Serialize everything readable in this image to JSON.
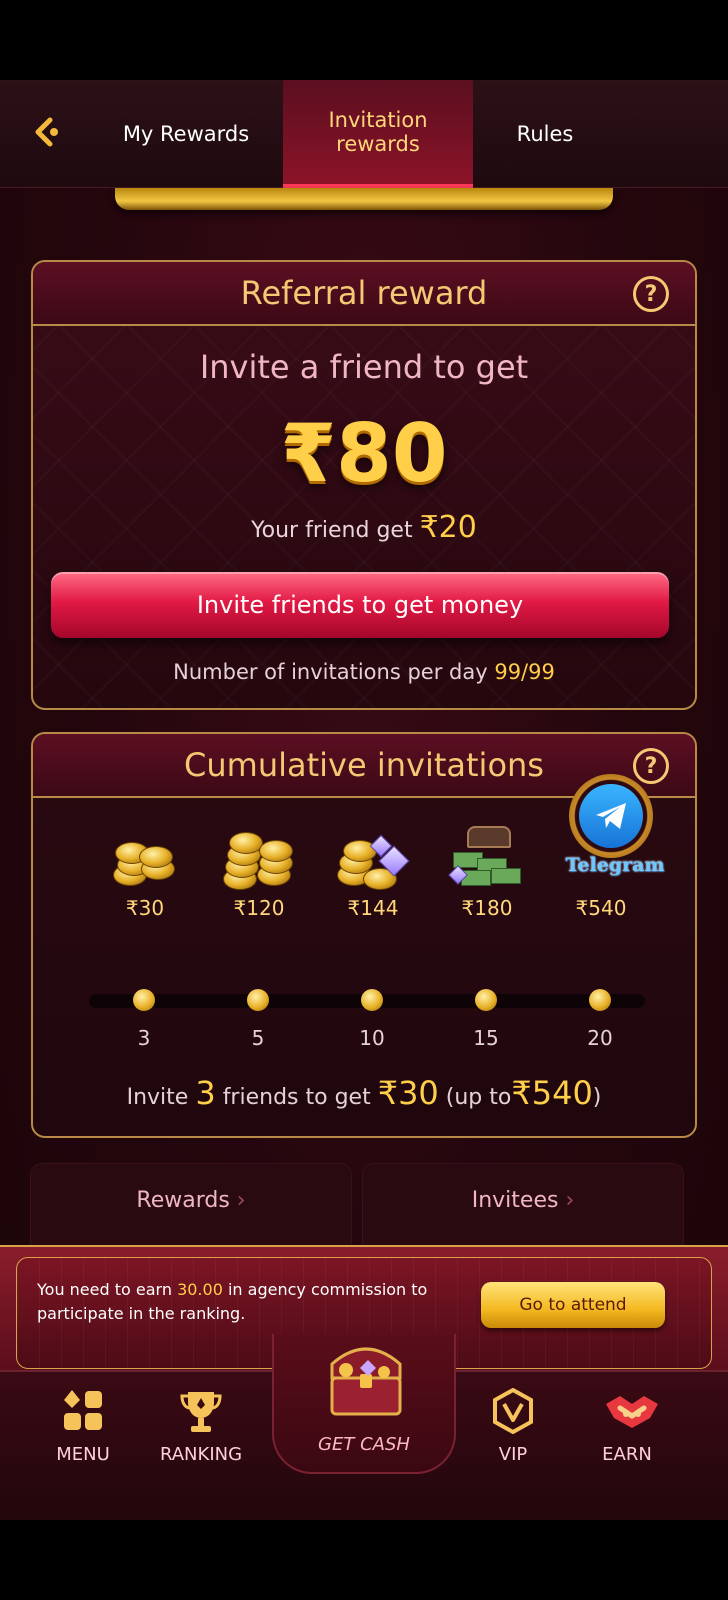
{
  "nav": {
    "tabs": [
      {
        "label": "My Rewards"
      },
      {
        "label": "Invitation rewards"
      },
      {
        "label": "Rules"
      }
    ]
  },
  "referral": {
    "title": "Referral reward",
    "invite_line": "Invite a friend to get",
    "amount": "₹80",
    "friend_get_label": "Your friend get",
    "friend_get_amount": "₹20",
    "button_label": "Invite friends to get money",
    "per_day_label": "Number of invitations per day",
    "per_day_count": "99/99"
  },
  "cumulative": {
    "title": "Cumulative invitations",
    "milestones": [
      {
        "reward": "₹30",
        "count": "3"
      },
      {
        "reward": "₹120",
        "count": "5"
      },
      {
        "reward": "₹144",
        "count": "10"
      },
      {
        "reward": "₹180",
        "count": "15"
      },
      {
        "reward": "₹540",
        "count": "20"
      }
    ],
    "telegram_label": "Telegram",
    "summary_prefix": "Invite",
    "summary_friends": "3",
    "summary_mid": "friends to get",
    "summary_amount": "₹30",
    "summary_up_to": "(up to",
    "summary_max": "₹540",
    "summary_close": ")"
  },
  "cards": {
    "rewards_label": "Rewards",
    "invitees_label": "Invitees"
  },
  "commission": {
    "text_prefix": "You need to earn",
    "amount": "30.00",
    "text_suffix": "in agency commission to participate in the ranking.",
    "button_label": "Go to attend"
  },
  "bottom_nav": {
    "items": [
      {
        "label": "MENU",
        "icon": "menu-grid-icon"
      },
      {
        "label": "RANKING",
        "icon": "trophy-icon"
      },
      {
        "label": "GET CASH",
        "icon": "treasure-chest-icon"
      },
      {
        "label": "VIP",
        "icon": "vip-badge-icon"
      },
      {
        "label": "EARN",
        "icon": "handshake-icon"
      }
    ]
  },
  "colors": {
    "accent_gold": "#ffcf4a",
    "primary_red": "#e21a45",
    "background": "#24060d"
  }
}
